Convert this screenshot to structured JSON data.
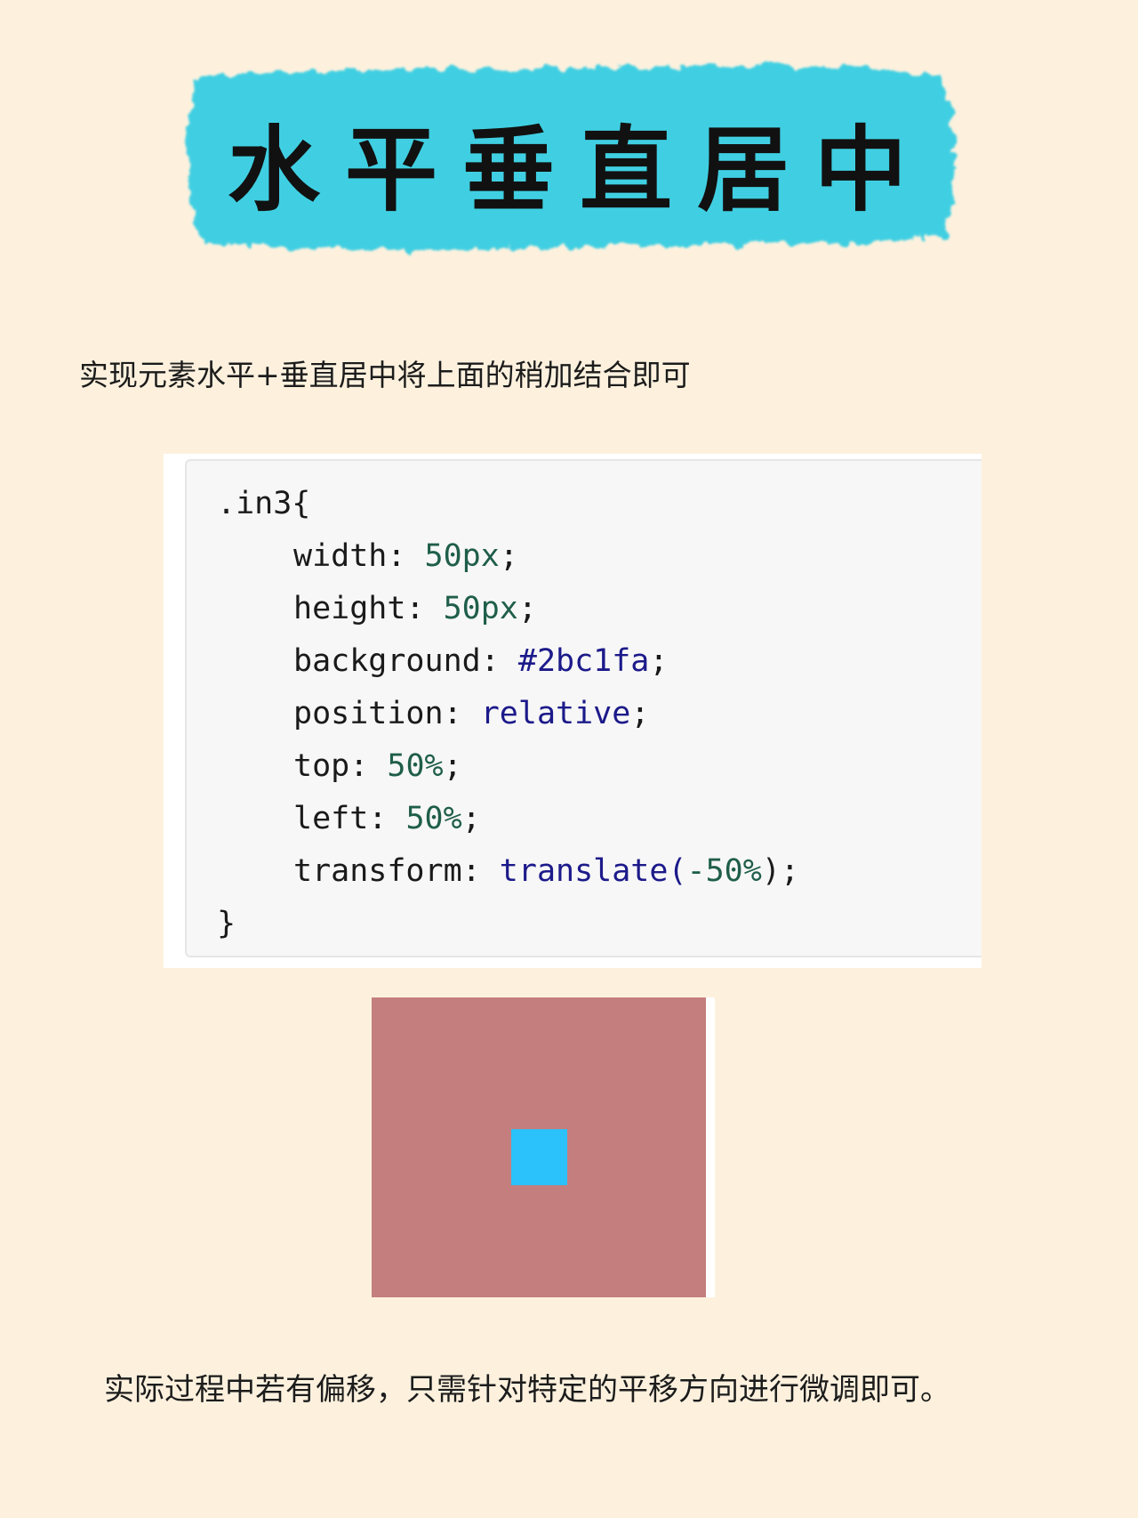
{
  "title": "水平垂直居中",
  "intro_text": "实现元素水平+垂直居中将上面的稍加结合即可",
  "code": {
    "selector": ".in3{",
    "lines": [
      {
        "prop": "width:",
        "value": "50px",
        "end": ";"
      },
      {
        "prop": "height:",
        "value": "50px",
        "end": ";"
      },
      {
        "prop": "background:",
        "value": "#2bc1fa",
        "end": ";"
      },
      {
        "prop": "position:",
        "value": "relative",
        "end": ";"
      },
      {
        "prop": "top:",
        "value": "50%",
        "end": ";"
      },
      {
        "prop": "left:",
        "value": "50%",
        "end": ";"
      },
      {
        "prop": "transform:",
        "fn": "translate(",
        "value": "-50%",
        "end": ");"
      }
    ],
    "closing": "}"
  },
  "demo": {
    "outer_color": "#c47e7e",
    "square_color": "#2bc1fa"
  },
  "outro_text": "实际过程中若有偏移，只需针对特定的平移方向进行微调即可。",
  "colors": {
    "background": "#fdf1de",
    "banner": "#3fcfe2"
  }
}
